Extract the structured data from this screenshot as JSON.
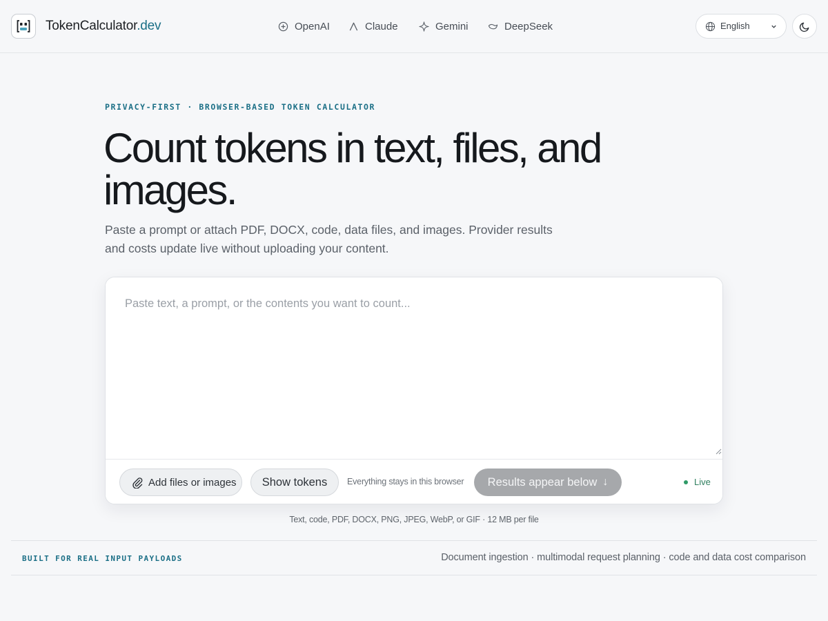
{
  "header": {
    "brand_name": "TokenCalculator",
    "brand_suffix": ".dev",
    "nav": [
      {
        "label": "OpenAI",
        "icon": "openai-icon"
      },
      {
        "label": "Claude",
        "icon": "claude-icon"
      },
      {
        "label": "Gemini",
        "icon": "gemini-icon"
      },
      {
        "label": "DeepSeek",
        "icon": "deepseek-icon"
      }
    ],
    "language": "English",
    "theme_icon": "moon-icon"
  },
  "hero": {
    "eyebrow": "PRIVACY-FIRST · BROWSER-BASED TOKEN CALCULATOR",
    "headline": "Count tokens in text, files, and images.",
    "subtitle": "Paste a prompt or attach PDF, DOCX, code, data files, and images. Provider results and costs update live without uploading your content."
  },
  "editor": {
    "placeholder": "Paste text, a prompt, or the contents you want to count...",
    "value": ""
  },
  "toolbar": {
    "attach_label": "Add files or images",
    "show_tokens_label": "Show tokens",
    "privacy_note": "Everything stays in this browser",
    "results_label": "Results appear below",
    "results_arrow": "↓",
    "live_label": "Live"
  },
  "formats_note": "Text, code, PDF, DOCX, PNG, JPEG, WebP, or GIF · 12 MB per file",
  "strip": {
    "left": "BUILT FOR REAL INPUT PAYLOADS",
    "right": "Document ingestion · multimodal request planning · code and data cost comparison"
  },
  "colors": {
    "accent": "#1b6f86",
    "live_green": "#2f9a67",
    "background": "#f6f7f9"
  }
}
